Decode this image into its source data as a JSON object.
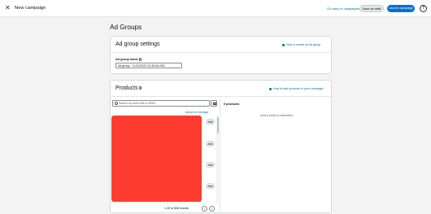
{
  "topbar": {
    "close_glyph": "✕",
    "title": "New campaign",
    "go_back_label": "Go back to campaigns",
    "save_draft_label": "Save as draft",
    "launch_label": "Launch campaign",
    "help_glyph": "?"
  },
  "page": {
    "heading": "Ad Groups"
  },
  "ad_group_settings": {
    "title": "Ad group settings",
    "help_link": "How to create an ad group",
    "name_label": "Ad group name",
    "name_value": "Ad group - 11/12/2024 22:45:54.945"
  },
  "products": {
    "title": "Products",
    "help_link": "How to add products to your campaign",
    "search_placeholder": "Search by book title or ASIN",
    "add_all_label": "Add all on this page",
    "add_label": "Add",
    "results_text": "1-30 of 808 results",
    "prev_glyph": "‹",
    "next_glyph": "›",
    "selected_count": "0 products",
    "empty_message": "Add a book to advertise"
  },
  "colors": {
    "accent": "#0070c9",
    "link": "#007185",
    "redacted_block": "#fd3c2f"
  }
}
